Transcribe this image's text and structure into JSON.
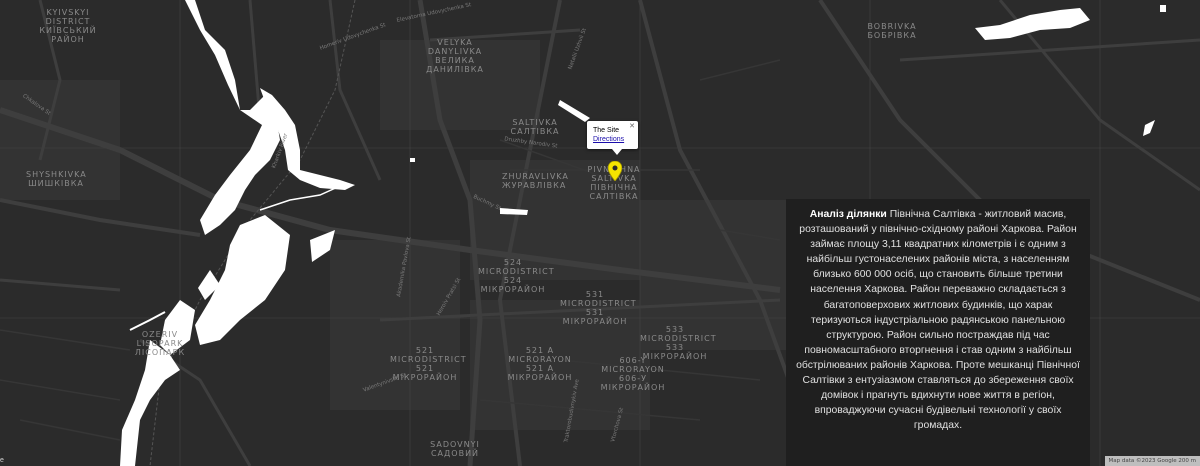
{
  "map": {
    "district_labels": [
      {
        "text": "Kyivskyi District Київський район"
      },
      {
        "text": "Velyka Danylivka Велика Данилівка"
      },
      {
        "text": "Saltivka Салтівка"
      },
      {
        "text": "Bobrivka Бобрівка"
      },
      {
        "text": "Shyshkivka Шишківка"
      },
      {
        "text": "Zhuravlivka Журавлівка"
      },
      {
        "text": "Pivnichna Saltivka Північна Салтівка"
      },
      {
        "text": "524 Microdistrict 524 мікрорайон"
      },
      {
        "text": "531 Microdistrict 531 мікрорайон"
      },
      {
        "text": "533 Microdistrict 533 мікрорайон"
      },
      {
        "text": "521 Microdistrict 521 мікрорайон"
      },
      {
        "text": "521 A Microrayon 521 А мікрорайон"
      },
      {
        "text": "606-Y Microrayon 606-У мікрорайон"
      },
      {
        "text": "Ozeriv Lisopark Лісопарк"
      },
      {
        "text": "Sadovnyi Садовий"
      }
    ],
    "street_labels": [
      {
        "text": "Homeriv Udovychenka St"
      },
      {
        "text": "Elevatorna Udovychenka St"
      },
      {
        "text": "Natalii Uzhvii St"
      },
      {
        "text": "Chkalova St"
      },
      {
        "text": "Kharkiv River"
      },
      {
        "text": "Druzhby Narodiv St"
      },
      {
        "text": "Buchmy St"
      },
      {
        "text": "Heroiv Pratsi St"
      },
      {
        "text": "Akademika Pavlova St"
      },
      {
        "text": "Traktorobudivnykiv Ave"
      },
      {
        "text": "Valentynivska St"
      },
      {
        "text": "Vtorchova St"
      }
    ],
    "marker": {
      "color": "#f5e500",
      "icon": "map-pin-icon"
    }
  },
  "info_window": {
    "title": "The Site",
    "link": "Directions",
    "close": "✕"
  },
  "panel": {
    "title": "Аналіз ділянки",
    "body": "Північна Салтівка - житловий масив, розташований у північно-східному районі Харкова. Район займає площу 3,11 квадратних кілометрів і є одним з найбільш густонаселених районів міста, з населенням близько 600 000 осіб, що становить більше третини населення Харкова. Район переважно складається з багатоповерхових житлових будинків, що харак теризуються індустріальною радянською панельною структурою. Район сильно постраждав під час повномасштабного вторгнення і став одним з найбільш обстрілюваних районів Харкова. Проте мешканці Північної Салтівки з ентузіазмом ставляться до збереження своїх домівок і прагнуть вдихнути нове життя в регіон, впроваджуючи сучасні будівельні технології у своїх громадах."
  },
  "attribution": "Map data ©2023 Google   200 m",
  "edge_label": "e",
  "colors": {
    "background": "#2b2b2b",
    "water": "#ffffff",
    "roads": "#3d3d3d",
    "panel": "#1f1f1f"
  }
}
